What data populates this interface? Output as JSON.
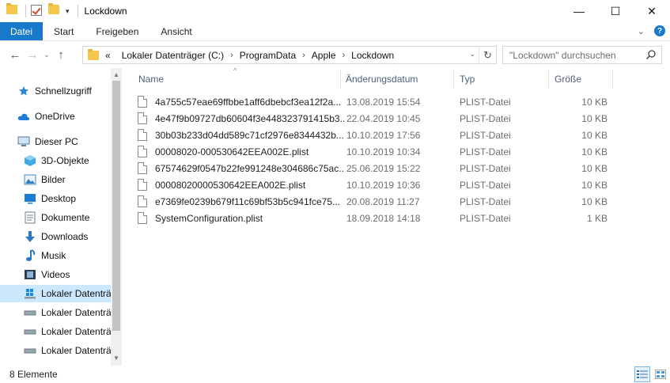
{
  "window": {
    "title": "Lockdown",
    "qat_dropdown": "▾",
    "buttons": {
      "minimize": "—",
      "maximize": "☐",
      "close": "✕"
    }
  },
  "ribbon": {
    "tabs": [
      "Datei",
      "Start",
      "Freigeben",
      "Ansicht"
    ],
    "expand": "⌄",
    "help": "?"
  },
  "nav": {
    "back": "←",
    "forward": "→",
    "recent": "⌄",
    "up": "↑"
  },
  "address": {
    "overflow": "«",
    "crumbs": [
      "Lokaler Datenträger (C:)",
      "ProgramData",
      "Apple",
      "Lockdown"
    ],
    "separator": "›",
    "dropdown": "⌄",
    "refresh": "↻"
  },
  "search": {
    "placeholder": "\"Lockdown\" durchsuchen"
  },
  "sidebar": {
    "items": [
      {
        "label": "Schnellzugriff",
        "icon": "star-icon"
      },
      {
        "label": "OneDrive",
        "icon": "cloud-icon"
      },
      {
        "label": "Dieser PC",
        "icon": "pc-icon"
      },
      {
        "label": "3D-Objekte",
        "icon": "cube-icon"
      },
      {
        "label": "Bilder",
        "icon": "pictures-icon"
      },
      {
        "label": "Desktop",
        "icon": "desktop-icon"
      },
      {
        "label": "Dokumente",
        "icon": "documents-icon"
      },
      {
        "label": "Downloads",
        "icon": "download-icon"
      },
      {
        "label": "Musik",
        "icon": "music-icon"
      },
      {
        "label": "Videos",
        "icon": "videos-icon"
      },
      {
        "label": "Lokaler Datenträ",
        "icon": "windows-drive-icon",
        "selected": true
      },
      {
        "label": "Lokaler Datenträ",
        "icon": "drive-icon"
      },
      {
        "label": "Lokaler Datenträ",
        "icon": "drive-icon"
      },
      {
        "label": "Lokaler Datenträ",
        "icon": "drive-icon"
      }
    ]
  },
  "list": {
    "columns": {
      "name": "Name",
      "date": "Änderungsdatum",
      "type": "Typ",
      "size": "Größe"
    },
    "sort_indicator": "^",
    "files": [
      {
        "name": "4a755c57eae69ffbbe1aff6dbebcf3ea12f2a...",
        "date": "13.08.2019 15:54",
        "type": "PLIST-Datei",
        "size": "10 KB"
      },
      {
        "name": "4e47f9b09727db60604f3e448323791415b3...",
        "date": "22.04.2019 10:45",
        "type": "PLIST-Datei",
        "size": "10 KB"
      },
      {
        "name": "30b03b233d04dd589c71cf2976e8344432b...",
        "date": "10.10.2019 17:56",
        "type": "PLIST-Datei",
        "size": "10 KB"
      },
      {
        "name": "00008020-000530642EEA002E.plist",
        "date": "10.10.2019 10:34",
        "type": "PLIST-Datei",
        "size": "10 KB"
      },
      {
        "name": "67574629f0547b22fe991248e304686c75ac...",
        "date": "25.06.2019 15:22",
        "type": "PLIST-Datei",
        "size": "10 KB"
      },
      {
        "name": "00008020000530642EEA002E.plist",
        "date": "10.10.2019 10:36",
        "type": "PLIST-Datei",
        "size": "10 KB"
      },
      {
        "name": "e7369fe0239b679f11c69bf53b5c941fce75...",
        "date": "20.08.2019 11:27",
        "type": "PLIST-Datei",
        "size": "10 KB"
      },
      {
        "name": "SystemConfiguration.plist",
        "date": "18.09.2018 14:18",
        "type": "PLIST-Datei",
        "size": "1 KB"
      }
    ]
  },
  "status": {
    "count": "8 Elemente"
  },
  "colors": {
    "accent": "#1979ca",
    "selection": "#cce8ff",
    "folder": "#f4c64c",
    "header_text": "#4c607a"
  }
}
